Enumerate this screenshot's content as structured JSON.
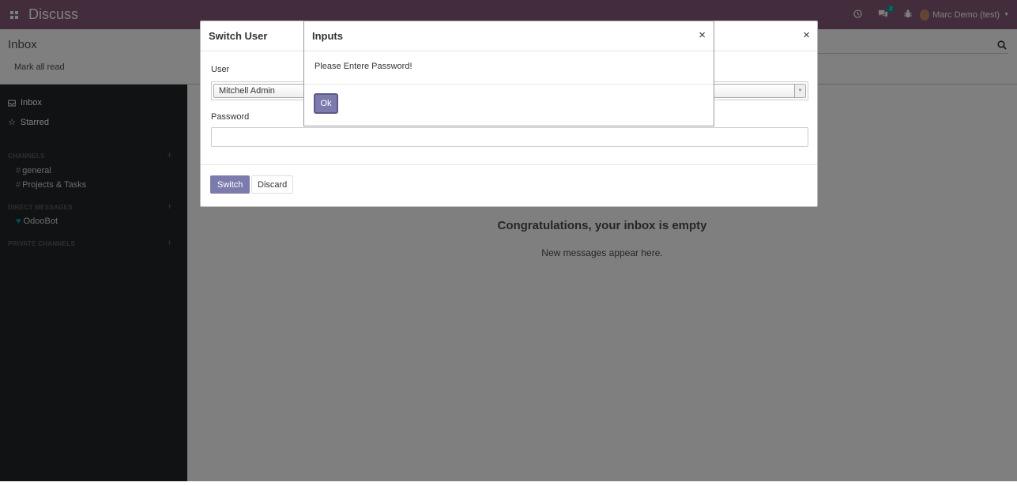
{
  "navbar": {
    "app_title": "Discuss",
    "chat_badge": "2",
    "user_name": "Marc Demo (test)"
  },
  "control_panel": {
    "breadcrumb": "Inbox",
    "mark_all_read": "Mark all read"
  },
  "sidebar": {
    "inbox": "Inbox",
    "starred": "Starred",
    "channels_header": "CHANNELS",
    "channels": [
      "general",
      "Projects & Tasks"
    ],
    "direct_messages_header": "DIRECT MESSAGES",
    "direct_messages": [
      "OdooBot"
    ],
    "private_channels_header": "PRIVATE CHANNELS"
  },
  "main": {
    "empty_title": "Congratulations, your inbox is empty",
    "empty_subtitle": "New messages appear here."
  },
  "switch_user_modal": {
    "title": "Switch User",
    "close": "×",
    "user_label": "User",
    "user_value": "Mitchell Admin",
    "password_label": "Password",
    "password_value": "",
    "switch_button": "Switch",
    "discard_button": "Discard"
  },
  "inputs_dialog": {
    "title": "Inputs",
    "close": "×",
    "message": "Please Entere Password!",
    "ok_button": "Ok"
  },
  "colors": {
    "brand": "#875a7b",
    "primary_button": "#7c7bad",
    "sidebar_bg": "#212529",
    "accent": "#00a09d"
  }
}
